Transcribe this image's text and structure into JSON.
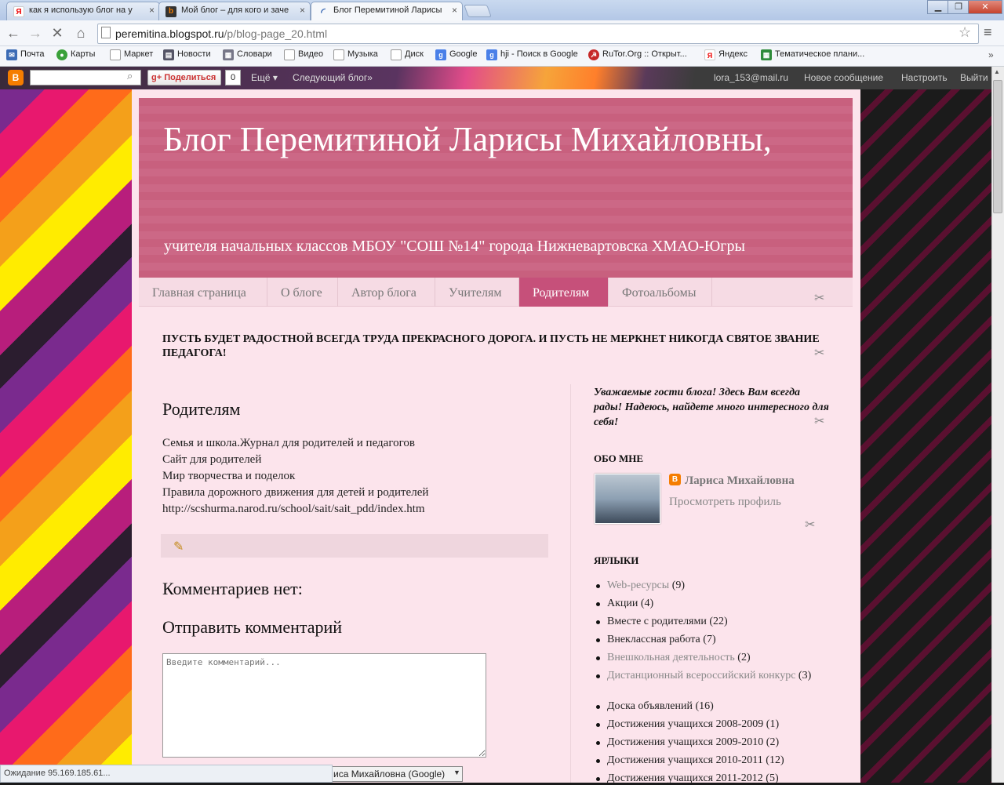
{
  "browser": {
    "tabs": [
      {
        "title": "как я использую блог на у",
        "icon": "yandex-icon"
      },
      {
        "title": "Мой блог – для кого и заче",
        "icon": "blogger-icon"
      },
      {
        "title": "Блог Перемитиной Ларисы",
        "icon": "loading-icon"
      }
    ],
    "url_host": "peremitina.blogspot.ru",
    "url_path": "/p/blog-page_20.html",
    "bookmarks": [
      "Почта",
      "Карты",
      "Маркет",
      "Новости",
      "Словари",
      "Видео",
      "Музыка",
      "Диск",
      "Google",
      "hji - Поиск в Google",
      "RuTor.Org :: Открыт...",
      "Яндекс",
      "Тематическое плани..."
    ],
    "status": "Ожидание 95.169.185.61..."
  },
  "blogger_bar": {
    "share_label": "Поделиться",
    "share_count": "0",
    "more_label": "Ещё ▾",
    "next_blog": "Следующий блог»",
    "email": "lora_153@mail.ru",
    "new_post": "Новое сообщение",
    "settings": "Настроить",
    "logout": "Выйти"
  },
  "blog": {
    "title": "Блог Перемитиной Ларисы Михайловны,",
    "description": "учителя начальных классов МБОУ \"СОШ №14\" города Нижневартовска ХМАО-Югры",
    "tabs": [
      "Главная страница",
      "О блоге",
      "Автор блога",
      "Учителям",
      "Родителям",
      "Фотоальбомы"
    ],
    "selected_tab": "Родителям",
    "quote": "ПУСТЬ БУДЕТ РАДОСТНОЙ ВСЕГДА ТРУДА ПРЕКРАСНОГО ДОРОГА. И ПУСТЬ НЕ МЕРКНЕТ НИКОГДА СВЯТОЕ ЗВАНИЕ ПЕДАГОГА!"
  },
  "post": {
    "title": "Родителям",
    "links": [
      "Семья и школа.Журнал для родителей и педагогов",
      "Сайт для родителей",
      "Мир творчества и поделок",
      "Правила дорожного движения для детей и родителей",
      "http://scshurma.narod.ru/school/sait/sait_pdd/index.htm"
    ],
    "no_comments": "Комментариев нет:",
    "send_comment": "Отправить комментарий",
    "comment_placeholder": "Введите комментарий...",
    "comment_as": "иса Михайловна (Google)"
  },
  "sidebar": {
    "welcome": "Уважаемые гости блога! Здесь Вам всегда рады! Надеюсь, найдете много интересного для себя!",
    "about_heading": "ОБО МНЕ",
    "profile_name": "Лариса Михайловна",
    "profile_link": "Просмотреть профиль",
    "labels_heading": "ЯРЛЫКИ",
    "labels": [
      {
        "name": "Web-ресурсы",
        "count": "(9)",
        "style": "gray"
      },
      {
        "name": "Акции",
        "count": "(4)",
        "style": "normal"
      },
      {
        "name": "Вместе с родителями",
        "count": "(22)",
        "style": "normal"
      },
      {
        "name": "Внеклассная работа",
        "count": "(7)",
        "style": "normal"
      },
      {
        "name": "Внешкольная деятельность",
        "count": "(2)",
        "style": "gray"
      },
      {
        "name": "Дистанционный всероссийский конкурс",
        "count": "(3)",
        "style": "gray"
      },
      {
        "name": "Доска объявлений",
        "count": "(16)",
        "style": "normal"
      },
      {
        "name": "Достижения учащихся 2008-2009",
        "count": "(1)",
        "style": "normal"
      },
      {
        "name": "Достижения учащихся 2009-2010",
        "count": "(2)",
        "style": "normal"
      },
      {
        "name": "Достижения учащихся 2010-2011",
        "count": "(12)",
        "style": "normal"
      },
      {
        "name": "Достижения учащихся 2011-2012",
        "count": "(5)",
        "style": "normal"
      }
    ]
  }
}
